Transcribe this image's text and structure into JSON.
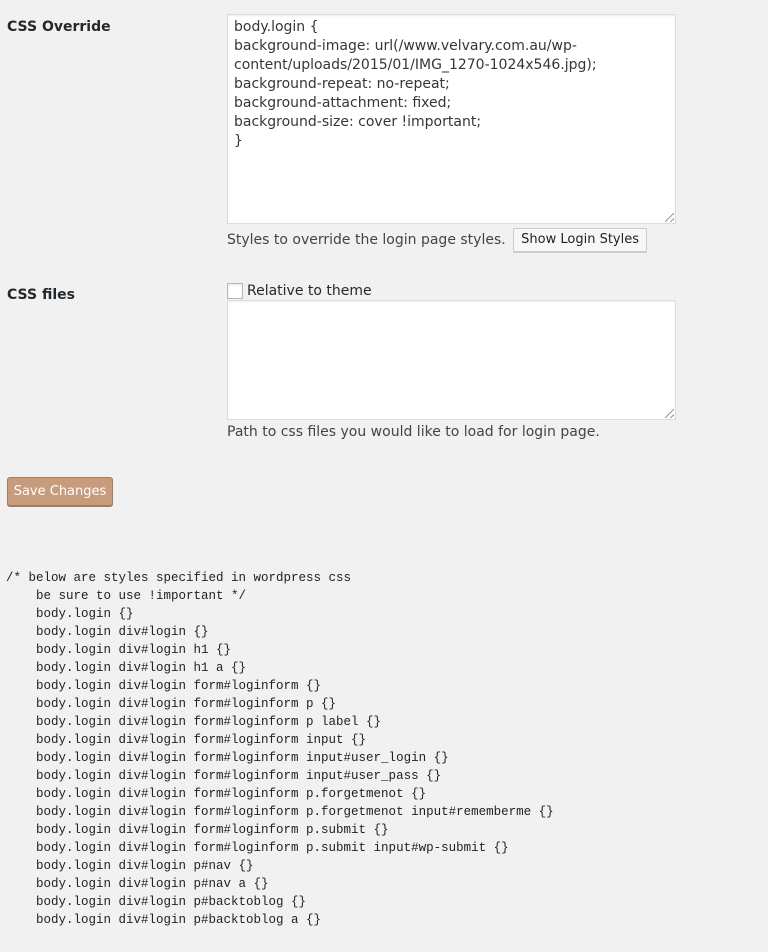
{
  "css_override": {
    "label": "CSS Override",
    "value": "body.login {\nbackground-image: url(/www.velvary.com.au/wp-\ncontent/uploads/2015/01/IMG_1270-1024x546.jpg);\nbackground-repeat: no-repeat;\nbackground-attachment: fixed;\nbackground-size: cover !important;\n}",
    "description": "Styles to override the login page styles.",
    "show_button_label": "Show Login Styles"
  },
  "css_files": {
    "label": "CSS files",
    "checkbox_label": "Relative to theme",
    "checkbox_checked": false,
    "value": "",
    "description": "Path to css files you would like to load for login page."
  },
  "save_button_label": "Save Changes",
  "styles_reference": "/* below are styles specified in wordpress css\n    be sure to use !important */\n    body.login {}\n    body.login div#login {}\n    body.login div#login h1 {}\n    body.login div#login h1 a {}\n    body.login div#login form#loginform {}\n    body.login div#login form#loginform p {}\n    body.login div#login form#loginform p label {}\n    body.login div#login form#loginform input {}\n    body.login div#login form#loginform input#user_login {}\n    body.login div#login form#loginform input#user_pass {}\n    body.login div#login form#loginform p.forgetmenot {}\n    body.login div#login form#loginform p.forgetmenot input#rememberme {}\n    body.login div#login form#loginform p.submit {}\n    body.login div#login form#loginform p.submit input#wp-submit {}\n    body.login div#login p#nav {}\n    body.login div#login p#nav a {}\n    body.login div#login p#backtoblog {}\n    body.login div#login p#backtoblog a {}",
  "colors": {
    "primary_button": "#c69c7d",
    "background": "#f1f1f1"
  }
}
